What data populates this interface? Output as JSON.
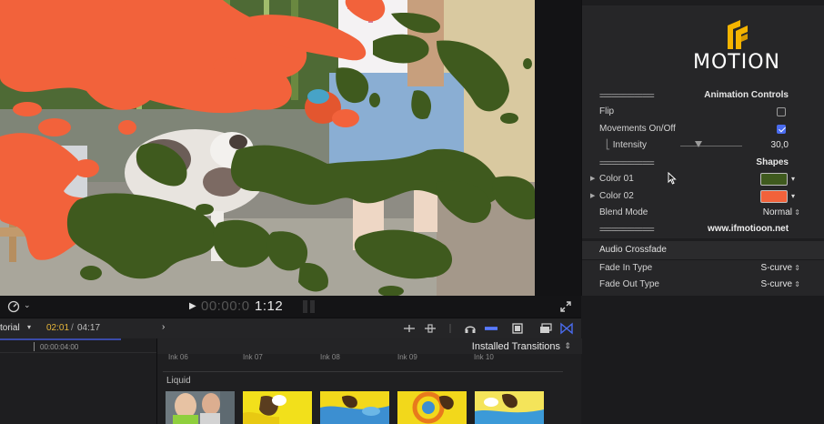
{
  "inspector": {
    "logo_text": "MOTION",
    "animation_controls": {
      "divider": "==============",
      "title": "Animation Controls"
    },
    "flip": {
      "label": "Flip",
      "checked": false
    },
    "movements": {
      "label": "Movements On/Off",
      "checked": true
    },
    "intensity": {
      "label": "Intensity",
      "value": "30,0",
      "level": 0.3
    },
    "shapes": {
      "divider": "==============",
      "title": "Shapes"
    },
    "color_01": {
      "label": "Color 01",
      "color": "#3f5a1e"
    },
    "color_02": {
      "label": "Color 02",
      "color": "#f2623b"
    },
    "blend_mode": {
      "label": "Blend Mode",
      "value": "Normal"
    },
    "website": {
      "divider": "==============",
      "text": "www.ifmotioon.net"
    },
    "audio": {
      "title": "Audio Crossfade",
      "fade_in": {
        "label": "Fade In Type",
        "value": "S-curve"
      },
      "fade_out": {
        "label": "Fade Out Type",
        "value": "S-curve"
      }
    }
  },
  "transport": {
    "timecode_dim": "00:00:0",
    "timecode_bright": "1:12"
  },
  "toolbar": {
    "project_name": "torial",
    "position": "02:01",
    "separator": "/",
    "duration": "04:17"
  },
  "timeline": {
    "ruler_label": "00:00:04:00"
  },
  "browser": {
    "category": "Installed Transitions",
    "row_labels": [
      "Ink 06",
      "Ink 07",
      "Ink 08",
      "Ink 09",
      "Ink 10"
    ],
    "group": "Liquid"
  },
  "colors": {
    "accent_blue": "#4a6cf0",
    "timecode_yellow": "#e5b53a",
    "splat_orange": "#f2623b",
    "splat_green": "#3f5a1e"
  }
}
